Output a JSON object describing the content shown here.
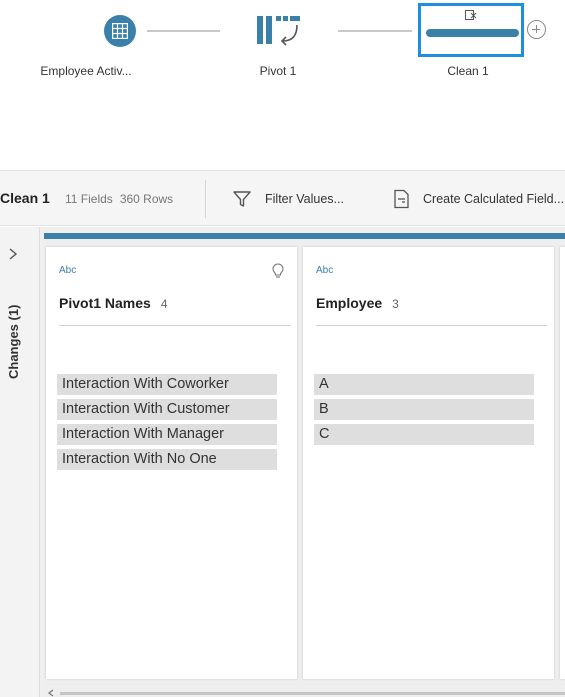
{
  "flow": {
    "nodes": [
      {
        "label": "Employee Activ...",
        "icon": "table-icon",
        "color": "#3b80a9"
      },
      {
        "label": "Pivot 1",
        "icon": "pivot-icon",
        "color": "#3b80a9"
      },
      {
        "label": "Clean 1",
        "icon": "clean-icon",
        "color": "#3b80a9",
        "selected": true
      }
    ],
    "add_step_icon": "plus-circle-icon"
  },
  "toolbar": {
    "title": "Clean 1",
    "fields": "11 Fields",
    "rows": "360 Rows",
    "filter_label": "Filter Values...",
    "calc_label": "Create Calculated Field..."
  },
  "changes": {
    "label": "Changes (1)"
  },
  "cards": [
    {
      "type": "Abc",
      "name": "Pivot1 Names",
      "count": "4",
      "values": [
        "Interaction With Coworker",
        "Interaction With Customer",
        "Interaction With Manager",
        "Interaction With No One"
      ]
    },
    {
      "type": "Abc",
      "name": "Employee",
      "count": "3",
      "values": [
        "A",
        "B",
        "C"
      ]
    }
  ],
  "colors": {
    "accent": "#3b80a9",
    "selection": "#1d8ee0",
    "value_bg": "#dedede"
  }
}
